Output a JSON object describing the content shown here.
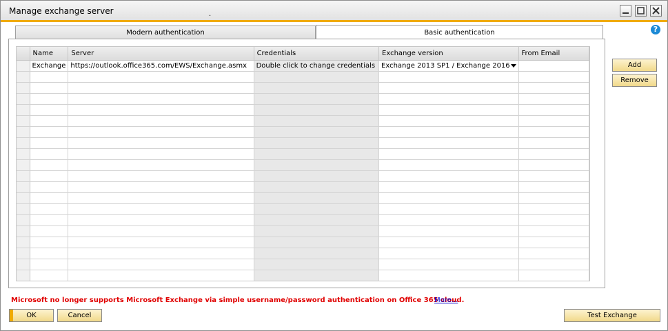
{
  "window": {
    "title": "Manage exchange server",
    "dot": "."
  },
  "tabs": [
    {
      "label": "Modern authentication",
      "active": false
    },
    {
      "label": "Basic authentication",
      "active": true
    }
  ],
  "grid": {
    "columns": [
      "Name",
      "Server",
      "Credentials",
      "Exchange version",
      "From Email"
    ],
    "rows": [
      {
        "name": "Exchange",
        "server": "https://outlook.office365.com/EWS/Exchange.asmx",
        "credentials": "Double click to change credentials",
        "exchange_version": "Exchange 2013 SP1 / Exchange 2016",
        "from_email": ""
      }
    ],
    "empty_rows": 19
  },
  "buttons": {
    "add": "Add",
    "remove": "Remove",
    "ok": "OK",
    "cancel": "Cancel",
    "test_exchange": "Test Exchange"
  },
  "warning": "Microsoft no longer supports Microsoft Exchange via simple username/password authentication on Office 365 cloud.",
  "more_link": "More...",
  "help_glyph": "?",
  "colors": {
    "accent": "#f0ab00",
    "warning": "#e00000",
    "help": "#1c8ad6",
    "link": "#0000cc"
  }
}
